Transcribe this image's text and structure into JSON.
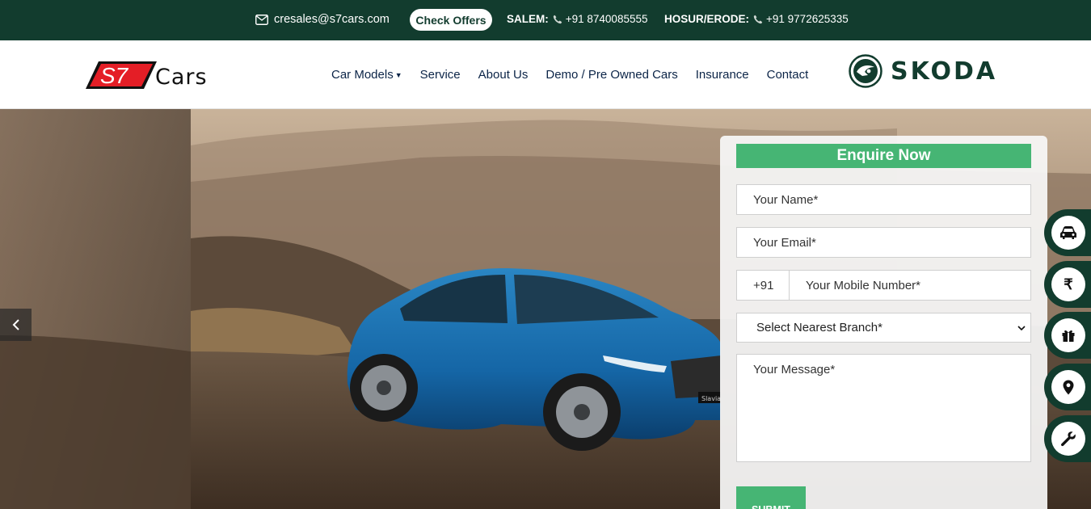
{
  "topbar": {
    "email": "cresales@s7cars.com",
    "offers_label": "Check Offers",
    "salem_label": "SALEM:",
    "salem_phone": "+91 8740085555",
    "hosur_label": "HOSUR/ERODE:",
    "hosur_phone": "+91 9772625335",
    "bg_color": "#123c2e"
  },
  "header": {
    "logo_text_s7": "S7",
    "logo_text_cars": "Cars",
    "nav": [
      {
        "label": "Car Models"
      },
      {
        "label": "Service"
      },
      {
        "label": "About Us"
      },
      {
        "label": "Demo / Pre Owned Cars"
      },
      {
        "label": "Insurance"
      },
      {
        "label": "Contact"
      }
    ],
    "brand": "SKODA"
  },
  "form": {
    "title": "Enquire Now",
    "name_placeholder": "Your Name*",
    "email_placeholder": "Your Email*",
    "country_code": "+91",
    "mobile_placeholder": "Your Mobile Number*",
    "branch_selected": "Select Nearest Branch*",
    "message_placeholder": "Your Message*",
    "submit_label": "SUBMIT",
    "accent_color": "#46b574"
  },
  "hero": {
    "car_badge": "Slavia"
  },
  "side_icons": [
    "car-icon",
    "rupee-icon",
    "gift-icon",
    "location-pin-icon",
    "wrench-icon"
  ],
  "side_glyphs": {
    "rupee": "₹"
  }
}
